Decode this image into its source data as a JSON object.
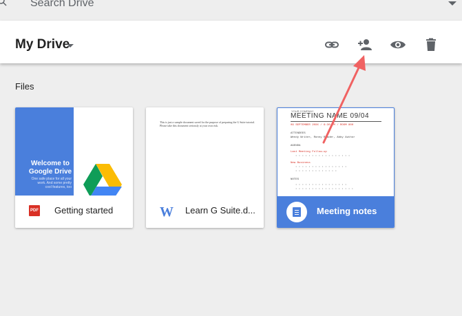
{
  "search": {
    "placeholder": "Search Drive"
  },
  "header": {
    "title": "My Drive",
    "icons": [
      "link-icon",
      "add-person-icon",
      "preview-eye-icon",
      "trash-icon"
    ]
  },
  "files_label": "Files",
  "cards": [
    {
      "name": "Getting started",
      "type_icon": "PDF",
      "preview_title": "Welcome to Google Drive",
      "preview_sub": "One safe place for all your work. And some pretty cool features, too"
    },
    {
      "name": "Learn G Suite.d...",
      "type_icon": "W",
      "preview_text": "This is just a sample document saved for the purpose of preparing the G Suite tutorial. Please take this document seriously at your own risk."
    },
    {
      "name": "Meeting notes",
      "preview_company": "YOUR COMPANY",
      "preview_title": "MEETING NAME 09/04",
      "preview_date": "09 SEPTEMBER 20XX / 6:30 PM / ROOM 800",
      "sections": [
        "ATTENDEES",
        "AGENDA",
        "NOTES"
      ],
      "attendees": "Wendy Writer, Ronny Reader, Abby Author",
      "agenda": [
        "Last Meeting Follow-up",
        "New Business"
      ]
    }
  ],
  "colors": {
    "accent": "#4a7fdc",
    "pdf": "#d93025",
    "arrow": "#f06262"
  }
}
